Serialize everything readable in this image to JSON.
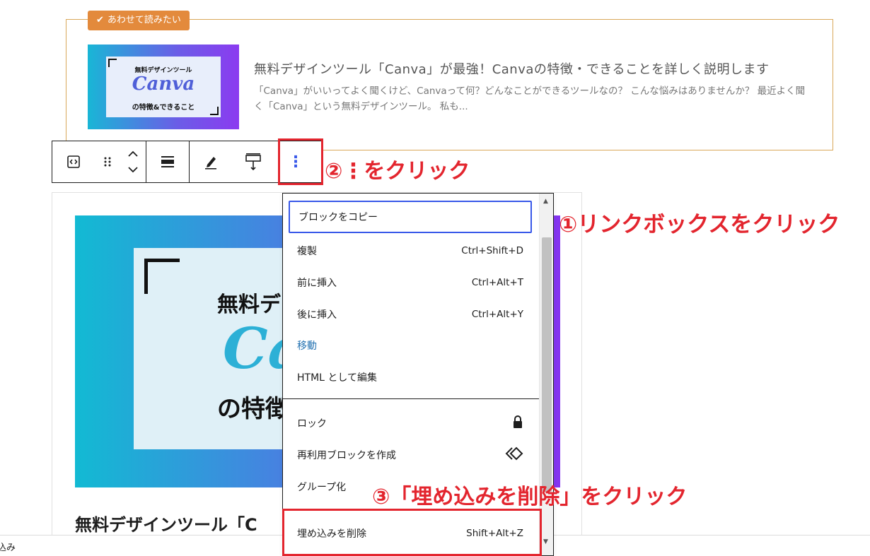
{
  "related": {
    "badge": "あわせて読みたい",
    "check_icon": "✔",
    "thumb_line1": "無料デザインツール",
    "thumb_canva": "Canva",
    "thumb_line2": "の特徴&できること",
    "title": "無料デザインツール「Canva」が最強！Canvaの特徴・できることを詳しく説明します",
    "excerpt": "「Canva」がいいってよく聞くけど、Canvaって何？どんなことができるツールなの？ こんな悩みはありませんか？ 最近よく聞く「Canva」という無料デザインツール。 私も..."
  },
  "toolbar": {
    "embed_icon": "embed-block-icon",
    "drag_icon": "drag-handle-icon",
    "move_icon": "move-up-down-icon",
    "align_icon": "align-icon",
    "edit_icon": "edit-pencil-icon",
    "resize_icon": "resize-icon",
    "more_icon": "more-options-icon"
  },
  "annotations": {
    "step1": "①リンクボックスをクリック",
    "step2": "②⋮をクリック",
    "step3": "③「埋め込みを削除」をクリック",
    "color": "#e3252e"
  },
  "embed": {
    "big_line1": "無料デ",
    "big_canva": "Ca",
    "big_line2": "の特徴",
    "title": "無料デザインツール「C"
  },
  "menu": {
    "items": [
      {
        "label": "ブロックをコピー",
        "shortcut": ""
      },
      {
        "label": "複製",
        "shortcut": "Ctrl+Shift+D"
      },
      {
        "label": "前に挿入",
        "shortcut": "Ctrl+Alt+T"
      },
      {
        "label": "後に挿入",
        "shortcut": "Ctrl+Alt+Y"
      },
      {
        "label": "移動",
        "shortcut": ""
      },
      {
        "label": "HTML として編集",
        "shortcut": ""
      },
      {
        "label": "ロック",
        "shortcut": ""
      },
      {
        "label": "再利用ブロックを作成",
        "shortcut": ""
      },
      {
        "label": "グループ化",
        "shortcut": ""
      },
      {
        "label": "埋め込みを削除",
        "shortcut": "Shift+Alt+Z"
      }
    ]
  },
  "bottom": {
    "label": "込み"
  }
}
